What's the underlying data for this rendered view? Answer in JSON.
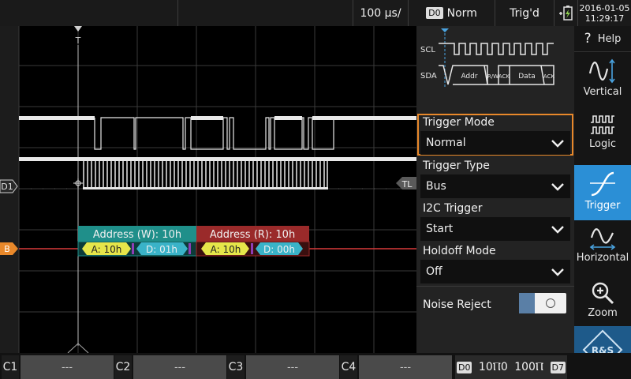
{
  "topbar": {
    "timebase": "100 µs/",
    "digital_tag": "D0",
    "trigger_mode_value": "Norm",
    "trigger_status": "Trig'd",
    "date": "2016-01-05",
    "time": "11:29:17"
  },
  "waveform": {
    "trigger_marker": "T",
    "d1_label": "D1",
    "tl_label": "TL",
    "bus_label": "B",
    "frames": [
      {
        "header": "Address (W): 10h",
        "addr": "A: 10h",
        "data": "D: 01h",
        "color": "#1f8f8a"
      },
      {
        "header": "Address (R): 10h",
        "addr": "A: 10h",
        "data": "D: 00h",
        "color": "#9a2a2a"
      }
    ],
    "colors": {
      "addr_chip": "#e6e64a",
      "data_chip": "#3ab3c8",
      "bus_line": "#d83a3a",
      "accent": "#e8882a"
    }
  },
  "diagram": {
    "scl": "SCL",
    "sda": "SDA",
    "addr": "Addr",
    "rw": "R/W",
    "ack": "ACK",
    "data": "Data"
  },
  "panel": {
    "trigger_mode": {
      "label": "Trigger Mode",
      "value": "Normal"
    },
    "trigger_type": {
      "label": "Trigger Type",
      "value": "Bus"
    },
    "i2c_trigger": {
      "label": "I2C Trigger",
      "value": "Start"
    },
    "holdoff_mode": {
      "label": "Holdoff Mode",
      "value": "Off"
    },
    "noise_reject": {
      "label": "Noise Reject",
      "state": "off"
    }
  },
  "toolbar": {
    "help": "Help",
    "help_icon": "?",
    "vertical": "Vertical",
    "logic": "Logic",
    "trigger": "Trigger",
    "horizontal": "Horizontal",
    "zoom": "Zoom",
    "brand_logo": "R&S"
  },
  "bottombar": {
    "channels": [
      {
        "tag": "C1",
        "value": "---"
      },
      {
        "tag": "C2",
        "value": "---"
      },
      {
        "tag": "C3",
        "value": "---"
      },
      {
        "tag": "C4",
        "value": "---"
      }
    ],
    "logic_left_tag": "D0",
    "logic_right_tag": "D7",
    "logic_value_a": "10Ⲡ0",
    "logic_value_b": "100Ⲡ"
  }
}
